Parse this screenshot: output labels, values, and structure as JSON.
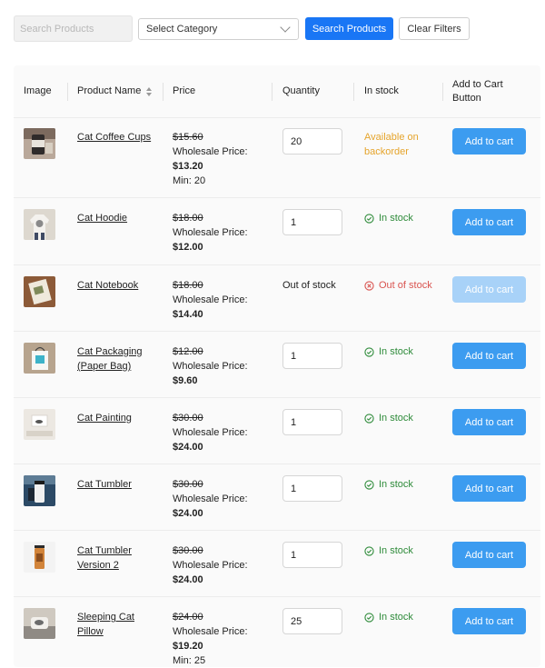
{
  "filters": {
    "search_placeholder": "Search Products",
    "category_selected": "Select Category",
    "search_button": "Search Products",
    "clear_button": "Clear Filters"
  },
  "table": {
    "headers": {
      "image": "Image",
      "product_name": "Product Name",
      "price": "Price",
      "quantity": "Quantity",
      "in_stock": "In stock",
      "add_to_cart_line1": "Add to Cart",
      "add_to_cart_line2": "Button"
    },
    "rows": [
      {
        "name_line1": "Cat Coffee Cups",
        "name_line2": "",
        "old_price": "$15.60",
        "wholesale_label": "Wholesale Price:",
        "price": "$13.20",
        "min": "Min: 20",
        "quantity": "20",
        "stock": "Available on backorder",
        "button": "Add to cart"
      },
      {
        "name_line1": "Cat Hoodie",
        "name_line2": "",
        "old_price": "$18.00",
        "wholesale_label": "Wholesale Price:",
        "price": "$12.00",
        "min": "",
        "quantity": "1",
        "stock": "In stock",
        "button": "Add to cart"
      },
      {
        "name_line1": "Cat Notebook",
        "name_line2": "",
        "old_price": "$18.00",
        "wholesale_label": "Wholesale Price:",
        "price": "$14.40",
        "min": "",
        "quantity": "Out of stock",
        "stock": "Out of stock",
        "button": "Add to cart"
      },
      {
        "name_line1": "Cat Packaging",
        "name_line2": "(Paper Bag)",
        "old_price": "$12.00",
        "wholesale_label": "Wholesale Price:",
        "price": "$9.60",
        "min": "",
        "quantity": "1",
        "stock": "In stock",
        "button": "Add to cart"
      },
      {
        "name_line1": "Cat Painting",
        "name_line2": "",
        "old_price": "$30.00",
        "wholesale_label": "Wholesale Price:",
        "price": "$24.00",
        "min": "",
        "quantity": "1",
        "stock": "In stock",
        "button": "Add to cart"
      },
      {
        "name_line1": "Cat Tumbler",
        "name_line2": "",
        "old_price": "$30.00",
        "wholesale_label": "Wholesale Price:",
        "price": "$24.00",
        "min": "",
        "quantity": "1",
        "stock": "In stock",
        "button": "Add to cart"
      },
      {
        "name_line1": "Cat Tumbler",
        "name_line2": "Version 2",
        "old_price": "$30.00",
        "wholesale_label": "Wholesale Price:",
        "price": "$24.00",
        "min": "",
        "quantity": "1",
        "stock": "In stock",
        "button": "Add to cart"
      },
      {
        "name_line1": "Sleeping Cat",
        "name_line2": "Pillow",
        "old_price": "$24.00",
        "wholesale_label": "Wholesale Price:",
        "price": "$19.20",
        "min": "Min: 25",
        "quantity": "25",
        "stock": "In stock",
        "button": "Add to cart"
      }
    ]
  },
  "colors": {
    "primary_button": "#1976f5",
    "cart_button": "#3c9cf0",
    "cart_button_disabled": "#a8d2f8",
    "in_stock": "#2e8b3a",
    "out_of_stock": "#d9534f",
    "backorder": "#e5a42b"
  }
}
